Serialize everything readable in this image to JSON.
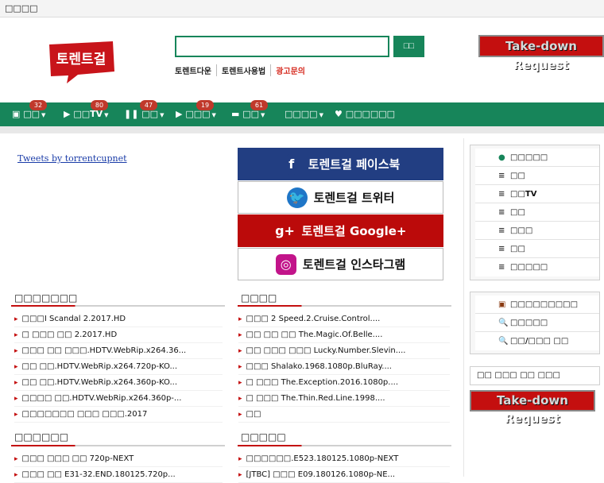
{
  "topbar": {
    "label": "□□□□"
  },
  "logo": {
    "text": "토렌트걸"
  },
  "search": {
    "placeholder": "",
    "button_label": "□□"
  },
  "sublinks": [
    "토렌트다운",
    "토렌트사용법",
    "광고문의"
  ],
  "takedown": {
    "label_main": "Take-down",
    "label_tail": "Request"
  },
  "nav": {
    "items": [
      {
        "label": "□□",
        "badge": "32",
        "icon": "film-icon"
      },
      {
        "label": "□□TV",
        "badge": "80",
        "icon": "play-icon"
      },
      {
        "label": "□□",
        "badge": "47",
        "icon": "pause-icon"
      },
      {
        "label": "□□□",
        "badge": "19",
        "icon": "video-icon"
      },
      {
        "label": "□□",
        "badge": "61",
        "icon": "image-icon"
      },
      {
        "label": "□□□□",
        "badge": "",
        "icon": ""
      },
      {
        "label": "□□□□□□",
        "badge": "",
        "icon": "heart-icon"
      }
    ]
  },
  "tweets_link": "Tweets by torrentcupnet",
  "social": [
    {
      "label": "토렌트걸 페이스북",
      "icon": "facebook-icon",
      "glyph": "f"
    },
    {
      "label": "토렌트걸 트위터",
      "icon": "twitter-icon",
      "glyph": "🐦"
    },
    {
      "label": "토렌트걸 Google+",
      "icon": "google-plus-icon",
      "glyph": "g+"
    },
    {
      "label": "토렌트걸 인스타그램",
      "icon": "instagram-icon",
      "glyph": "◎"
    }
  ],
  "sections": [
    {
      "title": "□□□□□□□",
      "items": [
        "□□□I Scandal 2.2017.HD",
        "□ □□□ □□ 2.2017.HD",
        "□□□ □□ □□□.HDTV.WebRip.x264.36...",
        "□□ □□.HDTV.WebRip.x264.720p-KO...",
        "□□ □□.HDTV.WebRip.x264.360p-KO...",
        "□□□□ □□.HDTV.WebRip.x264.360p-...",
        "□□□□□□□ □□□ □□□.2017"
      ]
    },
    {
      "title": "□□□□",
      "items": [
        "□□□ 2 Speed.2.Cruise.Control....",
        "□□ □□ □□ The.Magic.Of.Belle....",
        "□□ □□□ □□□ Lucky.Number.Slevin....",
        "□□□ Shalako.1968.1080p.BluRay....",
        "□ □□□ The.Exception.2016.1080p....",
        "□ □□□ The.Thin.Red.Line.1998....",
        "□□"
      ]
    },
    {
      "title": "□□□□□□",
      "items": [
        "□□□ □□□ □□ 720p-NEXT",
        "□□□ □□ E31-32.END.180125.720p..."
      ]
    },
    {
      "title": "□□□□□",
      "items": [
        "□□□□□□.E523.180125.1080p-NEXT",
        "[JTBC] □□□ E09.180126.1080p-NE..."
      ]
    }
  ],
  "sidebar_menu": [
    {
      "label": "□□□□□",
      "glyph": "●"
    },
    {
      "label": "□□",
      "glyph": "≡"
    },
    {
      "label": "□□TV",
      "glyph": "≡"
    },
    {
      "label": "□□",
      "glyph": "≡"
    },
    {
      "label": "□□□",
      "glyph": "≡"
    },
    {
      "label": "□□",
      "glyph": "≡"
    },
    {
      "label": "□□□□□",
      "glyph": "≡"
    }
  ],
  "sidebar_tools": [
    {
      "label": "□□□□□□□□□",
      "glyph": "▣"
    },
    {
      "label": "□□□□□",
      "glyph": "🔍"
    },
    {
      "label": "□□/□□□ □□",
      "glyph": "🔍"
    }
  ],
  "sidebar_note": "□□ □□□ □□ □□□"
}
